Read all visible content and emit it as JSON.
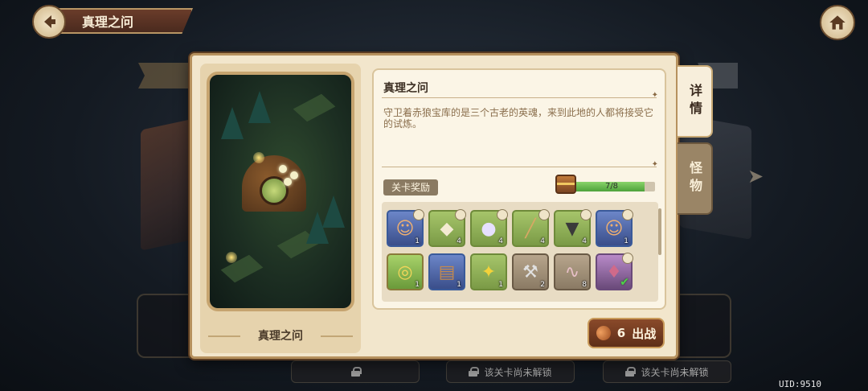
{
  "header": {
    "title": "真理之问"
  },
  "panel": {
    "stage_name": "真理之问",
    "info_title": "真理之问",
    "description": "守卫着赤狼宝库的是三个古老的英魂，来到此地的人都将接受它的试炼。",
    "reward_label": "关卡奖励",
    "progress_text": "7/8",
    "progress_fraction": 0.875,
    "tabs": [
      {
        "label": "详情",
        "selected": true
      },
      {
        "label": "怪物",
        "selected": false
      }
    ],
    "fight_button": {
      "cost": "6",
      "label": "出战"
    },
    "rewards": [
      {
        "icon": "hero-portrait-icon",
        "count": "1",
        "style": "blue",
        "badge": true
      },
      {
        "icon": "stone-icon",
        "count": "4",
        "style": "green",
        "badge": true
      },
      {
        "icon": "pearl-icon",
        "count": "4",
        "style": "green",
        "badge": true
      },
      {
        "icon": "stick-icon",
        "count": "4",
        "style": "green",
        "badge": true
      },
      {
        "icon": "drill-icon",
        "count": "4",
        "style": "green",
        "badge": true
      },
      {
        "icon": "hero-portrait-icon",
        "count": "1",
        "style": "blue",
        "badge": true
      },
      {
        "icon": "scroll-icon",
        "count": "1",
        "style": "gold",
        "badge": false
      },
      {
        "icon": "book-icon",
        "count": "1",
        "style": "blue",
        "badge": false
      },
      {
        "icon": "fish-icon",
        "count": "1",
        "style": "green",
        "badge": false
      },
      {
        "icon": "pickaxe-icon",
        "count": "2",
        "style": "brown",
        "badge": false
      },
      {
        "icon": "worm-icon",
        "count": "8",
        "style": "brown",
        "badge": false
      },
      {
        "icon": "crystal-icon",
        "count": "",
        "style": "purple",
        "badge": true,
        "claimed": true
      }
    ]
  },
  "background": {
    "locked_text": "该关卡尚未解锁",
    "uid": "UID:9510"
  },
  "colors": {
    "panel_bg": "#f2e6cc",
    "progress_fill": "#4da23a",
    "fight_button": "#6e3a20"
  }
}
